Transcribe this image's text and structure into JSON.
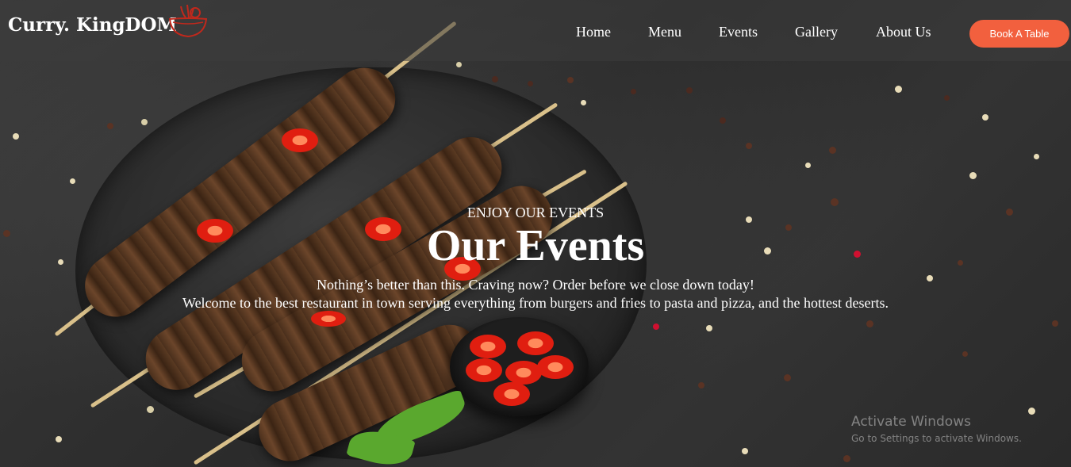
{
  "brand": {
    "name": "Curry. KingDOM",
    "logo_icon": "cooking-pot-icon",
    "logo_color": "#c0281c"
  },
  "nav": {
    "items": [
      "Home",
      "Menu",
      "Events",
      "Gallery",
      "About Us"
    ],
    "cta_label": "Book A Table",
    "cta_color": "#f2603e"
  },
  "hero": {
    "eyebrow": "ENJOY OUR EVENTS",
    "title": "Our Events",
    "line1": "Nothing’s better than this. Craving now? Order before we close down today!",
    "line2": "Welcome to the best restaurant in town serving everything from burgers and fries to pasta and pizza, and the hottest deserts.",
    "background_image": "grilled-kebab-skewers-on-slate-with-chili-peppers"
  },
  "watermark": {
    "title": "Activate Windows",
    "subtitle": "Go to Settings to activate Windows."
  }
}
